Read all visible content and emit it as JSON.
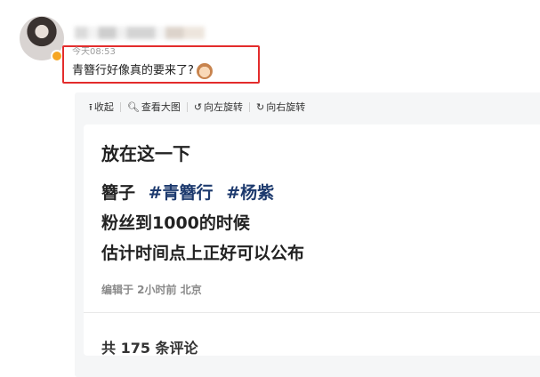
{
  "post": {
    "timestamp": "今天08:53",
    "text": "青簪行好像真的要来了?",
    "emoji_icon": "cat-face-icon"
  },
  "toolbar": {
    "collapse_label": "收起",
    "collapse_icon": "upload-arrow-icon",
    "view_large_label": "查看大图",
    "view_large_icon": "magnifier-icon",
    "rotate_left_label": "向左旋转",
    "rotate_left_icon": "rotate-left-icon",
    "rotate_right_label": "向右旋转",
    "rotate_right_icon": "rotate-right-icon"
  },
  "image_content": {
    "line1": "放在这一下",
    "line2_prefix": "簪子",
    "tag1": "#青簪行",
    "tag2": "#杨紫",
    "line3": "粉丝到1000的时候",
    "line4": "估计时间点上正好可以公布",
    "edit_meta": "编辑于 2小时前 北京",
    "comment_count": "共 175 条评论"
  },
  "colors": {
    "highlight_border": "#e32c2c",
    "tag_color": "#1d3a6e",
    "badge": "#f6a623"
  }
}
